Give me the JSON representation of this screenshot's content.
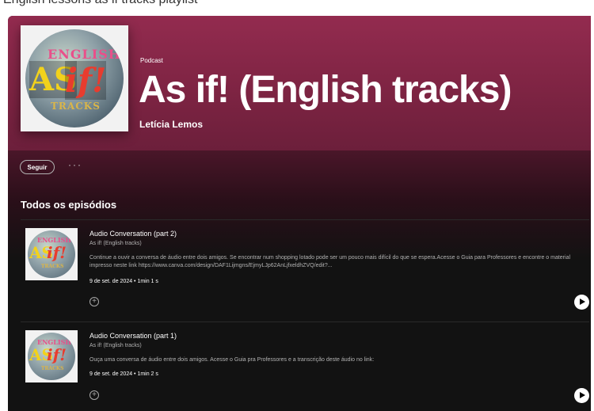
{
  "top_strip_text": "English lessons as if tracks playlist",
  "podcast": {
    "kicker": "Podcast",
    "title": "As if! (English tracks)",
    "author": "Letícia Lemos",
    "cover_text": {
      "line1": "ENGLISH",
      "as": "AS",
      "if": "if!",
      "tracks": "TRACKS"
    }
  },
  "actions": {
    "follow_label": "Seguir",
    "more_label": "···"
  },
  "section_title": "Todos os episódios",
  "episodes": [
    {
      "title": "Audio Conversation (part 2)",
      "show": "As if! (English tracks)",
      "description": "Continue a ouvir a conversa de áudio entre dois amigos. Se encontrar num shopping lotado pode ser um pouco mais difícil do que se espera.Acesse o Guia para Professores e encontre o material impresso neste link https://www.canva.com/design/DAF1Lijmgns/EjmyLJp62AnLjfxeldhZVQ/edit?...",
      "meta": "9 de set. de 2024 • 1min 1 s"
    },
    {
      "title": "Audio Conversation (part 1)",
      "show": "As if! (English tracks)",
      "description": "Ouça uma conversa de áudio entre dois amigos. Acesse o Guia pra Professores e a transcrição deste áudio no link:",
      "meta": "9 de set. de 2024 • 1min 2 s"
    }
  ],
  "icons": {
    "add": "add-circle-icon",
    "play": "play-icon"
  },
  "colors": {
    "hero": "#932b4f",
    "background": "#121212"
  }
}
